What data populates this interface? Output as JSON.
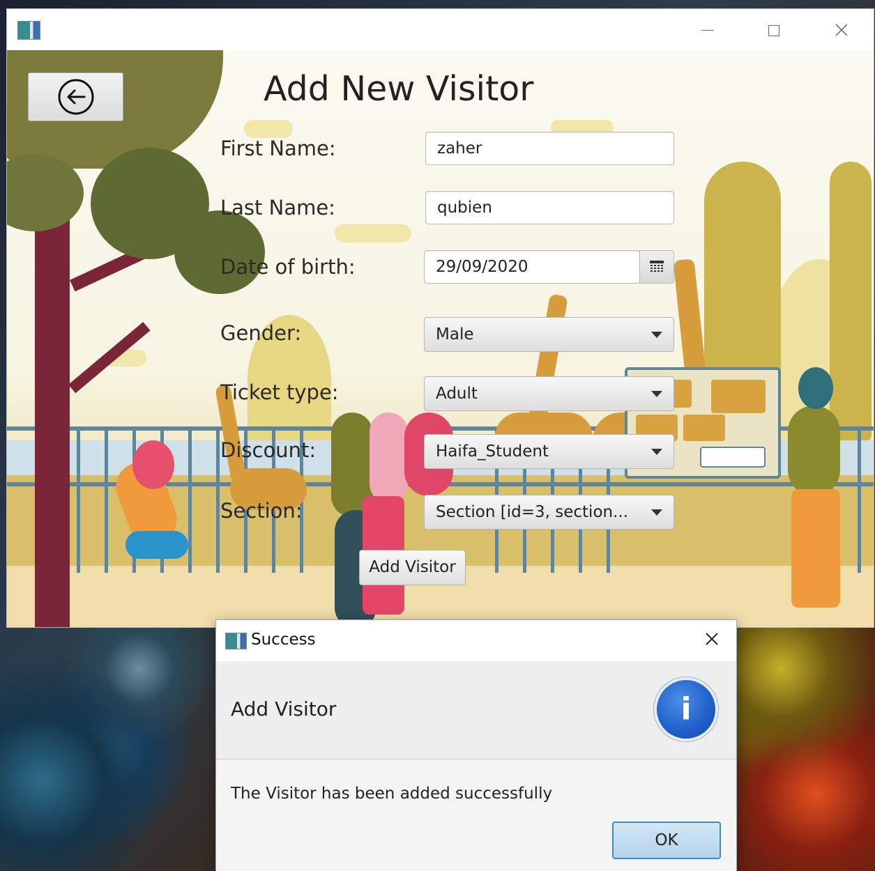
{
  "main_window": {
    "icons": {
      "app": "app-icon",
      "minimize": "minimize-icon",
      "maximize": "maximize-icon",
      "close": "close-icon"
    }
  },
  "form": {
    "title": "Add New Visitor",
    "back_icon": "back-arrow-icon",
    "first_name": {
      "label": "First Name:",
      "value": "zaher"
    },
    "last_name": {
      "label": "Last Name:",
      "value": "qubien"
    },
    "date_of_birth": {
      "label": "Date of birth:",
      "value": "29/09/2020",
      "icon": "calendar-icon"
    },
    "gender": {
      "label": "Gender:",
      "selected": "Male"
    },
    "ticket_type": {
      "label": "Ticket type:",
      "selected": "Adult"
    },
    "discount": {
      "label": "Discount:",
      "selected": "Haifa_Student"
    },
    "section": {
      "label": "Section:",
      "selected": "Section [id=3, section..."
    },
    "submit_label": "Add Visitor"
  },
  "dialog": {
    "title": "Success",
    "header": "Add Visitor",
    "content": "The Visitor has been added successfully",
    "ok_label": "OK",
    "info_glyph": "i",
    "close_glyph": "✕",
    "accent": "#3e8ac6",
    "info_color": "#1e5fc9"
  }
}
